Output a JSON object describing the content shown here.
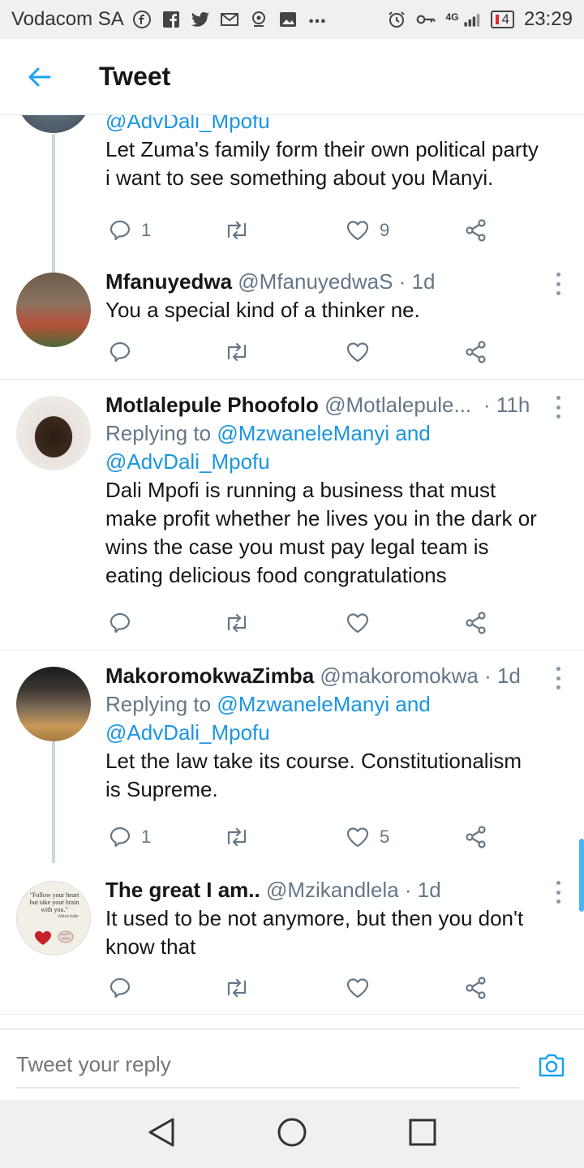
{
  "status_bar": {
    "carrier": "Vodacom SA",
    "network": "4G",
    "battery": "4",
    "time": "23:29",
    "icons": [
      "facebook-icon",
      "facebook-f-icon",
      "twitter-icon",
      "gmail-icon",
      "location-icon",
      "gallery-icon",
      "more-dots-icon",
      "alarm-icon",
      "key-icon",
      "signal-icon",
      "battery-icon"
    ]
  },
  "header": {
    "title": "Tweet"
  },
  "tweets": [
    {
      "reply_to_2": "@AdvDali_Mpofu",
      "text_lines": [
        "Let Zuma's family form their own political party",
        "i want to see something about you Manyi."
      ],
      "reply_count": "1",
      "like_count": "9"
    },
    {
      "name": "Mfanuyedwa",
      "handle": "@MfanuyedwaS",
      "time": "· 1d",
      "text_lines": [
        "You a special kind of a thinker ne."
      ],
      "reply_count": "",
      "like_count": ""
    },
    {
      "name": "Motlalepule Phoofolo",
      "handle": "@Motlalepule...",
      "time": "· 11h",
      "replying_label": "Replying to",
      "reply_to_1": "@MzwaneleManyi",
      "and_label": "and",
      "reply_to_2": "@AdvDali_Mpofu",
      "text_lines": [
        "Dali Mpofi is running a business that must",
        "make profit whether he lives you in the dark or",
        "wins the case you must pay legal team is",
        "eating delicious food congratulations"
      ],
      "reply_count": "",
      "like_count": ""
    },
    {
      "name": "MakoromokwaZimba",
      "handle": "@makoromokwa",
      "time": "· 1d",
      "replying_label": "Replying to",
      "reply_to_1": "@MzwaneleManyi",
      "and_label": "and",
      "reply_to_2": "@AdvDali_Mpofu",
      "text_lines": [
        "Let the law take its course. Constitutionalism",
        "is Supreme."
      ],
      "reply_count": "1",
      "like_count": "5"
    },
    {
      "name": "The great I am..",
      "handle": "@Mzikandlela",
      "time": "· 1d",
      "avatar_text": [
        "\"Follow your heart",
        "but take your brain",
        "with you.\"",
        "-Alfred Adler"
      ],
      "text_lines": [
        "It used to be not anymore, but then you don't",
        "know that"
      ],
      "reply_count": "",
      "like_count": ""
    }
  ],
  "reply_bar": {
    "placeholder": "Tweet your reply"
  },
  "colors": {
    "accent": "#1da1f2",
    "link": "#1b95e0",
    "secondary_text": "#657786"
  }
}
